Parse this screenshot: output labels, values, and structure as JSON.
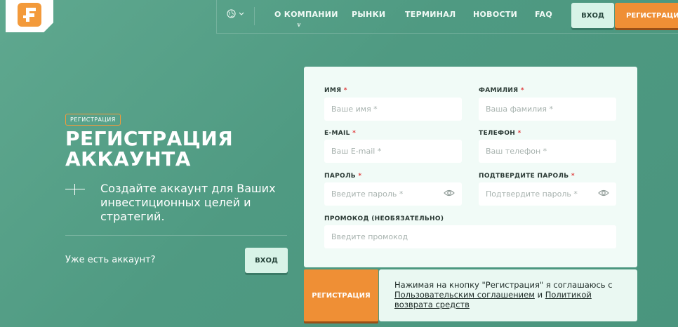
{
  "header": {
    "nav": [
      "О КОМПАНИИ",
      "РЫНКИ",
      "ТЕРМИНАЛ",
      "НОВОСТИ",
      "FAQ"
    ],
    "nav_sub_glyph": "⩛",
    "login": "ВХОД",
    "register": "РЕГИСТРАЦИЯ",
    "logo_color": "#f39a3b"
  },
  "hero": {
    "tag": "РЕГИСТРАЦИЯ",
    "title_line1": "РЕГИСТРАЦИЯ",
    "title_line2": "АККАУНТА",
    "subtitle": "Создайте аккаунт для Ваших инвестиционных целей и стратегий.",
    "have_account": "Уже есть аккаунт?",
    "login": "ВХОД"
  },
  "form": {
    "first_name": {
      "label": "ИМЯ",
      "placeholder": "Ваше имя *"
    },
    "last_name": {
      "label": "ФАМИЛИЯ",
      "placeholder": "Ваша фамилия *"
    },
    "email": {
      "label": "E-MAIL",
      "placeholder": "Ваш E-mail *"
    },
    "phone": {
      "label": "ТЕЛЕФОН",
      "placeholder": "Ваш телефон *"
    },
    "password": {
      "label": "ПАРОЛЬ",
      "placeholder": "Введите пароль *"
    },
    "confirm": {
      "label": "ПОДТВЕРДИТЕ ПАРОЛЬ",
      "placeholder": "Подтвердите пароль *"
    },
    "promo": {
      "label": "ПРОМОКОД (НЕОБЯЗАТЕЛЬНО)",
      "placeholder": "Введите промокод"
    },
    "required_mark": "*",
    "submit": "РЕГИСТРАЦИЯ"
  },
  "consent": {
    "prefix": "Нажимая на кнопку \"Регистрация\" я соглашаюсь с",
    "link1": "Пользовательским соглашением",
    "and": "и",
    "link2": "Политикой возврата средств"
  }
}
